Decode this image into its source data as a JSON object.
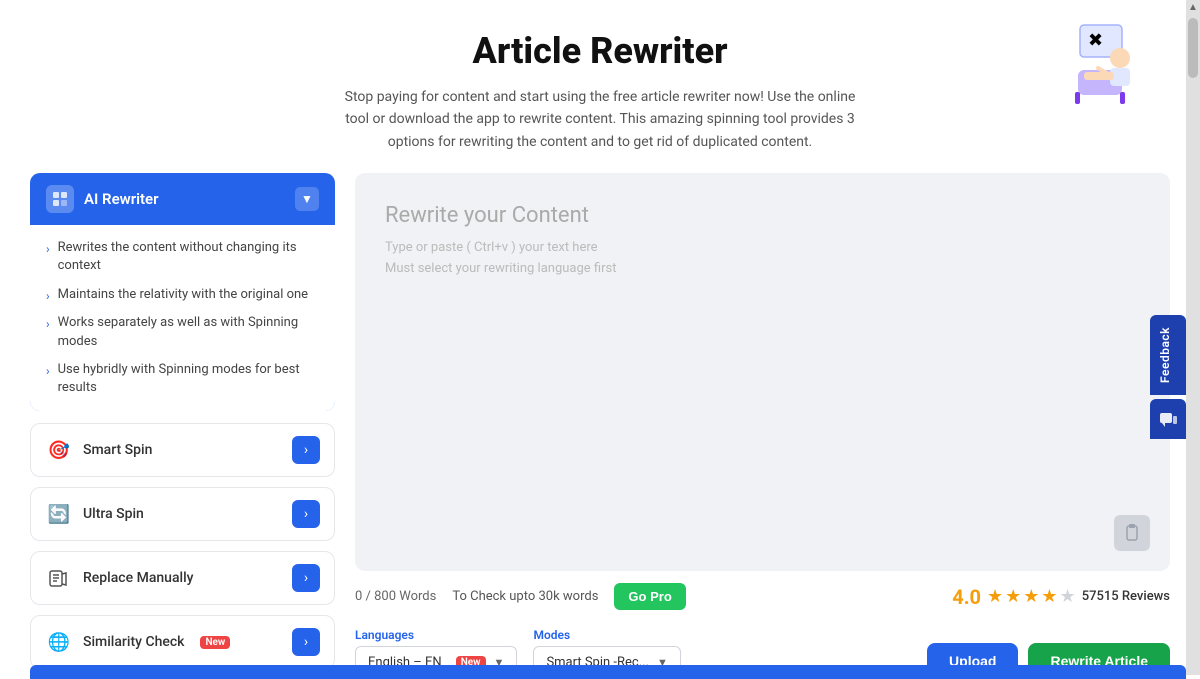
{
  "header": {
    "title": "Article Rewriter",
    "description": "Stop paying for content and start using the free article rewriter now! Use the online tool or download the app to rewrite content. This amazing spinning tool provides 3 options for rewriting the content and to get rid of duplicated content."
  },
  "sidebar": {
    "ai_rewriter": {
      "label": "AI Rewriter",
      "features": [
        "Rewrites the content without changing its context",
        "Maintains the relativity with the original one",
        "Works separately as well as with Spinning modes",
        "Use hybridly with Spinning modes for best results"
      ]
    },
    "tools": [
      {
        "id": "smart-spin",
        "label": "Smart Spin",
        "icon": "🎯",
        "badge": null
      },
      {
        "id": "ultra-spin",
        "label": "Ultra Spin",
        "icon": "🔄",
        "badge": null
      },
      {
        "id": "replace-manually",
        "label": "Replace Manually",
        "icon": "📋",
        "badge": null
      },
      {
        "id": "similarity-check",
        "label": "Similarity Check",
        "icon": "🌐",
        "badge": "New"
      }
    ]
  },
  "editor": {
    "placeholder_title": "Rewrite your Content",
    "placeholder_text": "Type or paste ( Ctrl+v ) your text here",
    "placeholder_subtext": "Must select your rewriting language first"
  },
  "word_count": {
    "current": "0",
    "max": "800",
    "label": "0 / 800 Words",
    "pro_text": "To Check upto 30k words",
    "go_pro_label": "Go Pro"
  },
  "rating": {
    "score": "4.0",
    "reviews_count": "57515",
    "reviews_label": "57515 Reviews"
  },
  "controls": {
    "languages_label": "Languages",
    "modes_label": "Modes",
    "language_value": "English – EN",
    "language_badge": "New",
    "mode_value": "Smart Spin -Rec...",
    "upload_label": "Upload",
    "rewrite_label": "Rewrite Article"
  },
  "feedback": {
    "tab_label": "Feedback"
  }
}
